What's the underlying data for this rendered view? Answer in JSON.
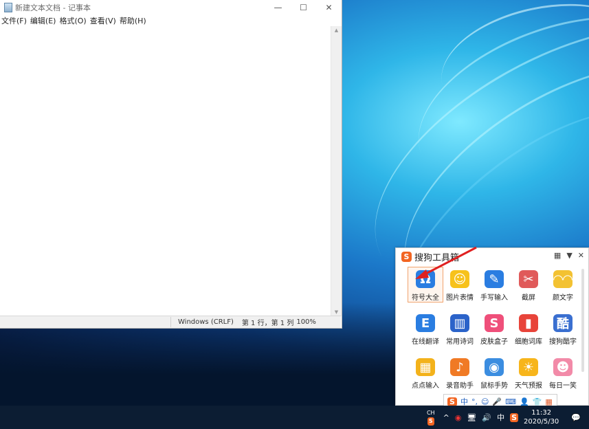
{
  "notepad": {
    "title": "新建文本文档 - 记事本",
    "controls": {
      "minimize": "—",
      "maximize": "☐",
      "close": "✕"
    },
    "menu": [
      "文件(F)",
      "编辑(E)",
      "格式(O)",
      "查看(V)",
      "帮助(H)"
    ],
    "status": {
      "line_ending": "Windows (CRLF)",
      "position": "第 1 行，第 1 列",
      "zoom": "100%"
    }
  },
  "toolbox": {
    "logo": "S",
    "title": "搜狗工具箱",
    "header_buttons": {
      "layout": "▦",
      "dropdown": "▼",
      "close": "✕"
    },
    "tools": [
      {
        "label": "符号大全",
        "glyph": "Ω",
        "color": "#2a7de1",
        "icon": "omega-icon",
        "selected": true
      },
      {
        "label": "图片表情",
        "glyph": "☺",
        "color": "#f7c21b",
        "icon": "smiley-icon",
        "selected": false
      },
      {
        "label": "手写输入",
        "glyph": "✎",
        "color": "#2a7de1",
        "icon": "pen-icon",
        "selected": false
      },
      {
        "label": "截屏",
        "glyph": "✂",
        "color": "#e05a5a",
        "icon": "scissors-icon",
        "selected": false
      },
      {
        "label": "颜文字",
        "glyph": "◠◠",
        "color": "#f3c232",
        "icon": "kaomoji-icon",
        "selected": false
      },
      {
        "label": "在线翻译",
        "glyph": "E",
        "color": "#2a7de1",
        "icon": "translate-icon",
        "selected": false
      },
      {
        "label": "常用诗词",
        "glyph": "▥",
        "color": "#2b63c9",
        "icon": "book-icon",
        "selected": false
      },
      {
        "label": "皮肤盒子",
        "glyph": "S",
        "color": "#ef4f7a",
        "icon": "shirt-icon",
        "selected": false
      },
      {
        "label": "细胞词库",
        "glyph": "▮",
        "color": "#e8443a",
        "icon": "dictionary-icon",
        "selected": false
      },
      {
        "label": "搜狗酷字",
        "glyph": "酷",
        "color": "#3a6fd0",
        "icon": "cool-font-icon",
        "selected": false
      },
      {
        "label": "点点输入",
        "glyph": "▦",
        "color": "#f3b21b",
        "icon": "dot-input-icon",
        "selected": false
      },
      {
        "label": "录音助手",
        "glyph": "♪",
        "color": "#f07a25",
        "icon": "recorder-icon",
        "selected": false
      },
      {
        "label": "鼠标手势",
        "glyph": "◉",
        "color": "#3b8de0",
        "icon": "mouse-icon",
        "selected": false
      },
      {
        "label": "天气预报",
        "glyph": "☀",
        "color": "#f7b51b",
        "icon": "sun-icon",
        "selected": false
      },
      {
        "label": "每日一笑",
        "glyph": "☻",
        "color": "#f28aa8",
        "icon": "laugh-icon",
        "selected": false
      }
    ]
  },
  "imebar": {
    "logo": "S",
    "mode": "中",
    "punct": "°,",
    "emoji": "☺",
    "mic": "🎤",
    "keyboard": "⌨",
    "user": "👤",
    "skin": "👕",
    "grid": "▦"
  },
  "taskbar": {
    "lang": "CH",
    "ime_logo": "S",
    "chevron": "^",
    "network": "🖥",
    "volume": "🔊",
    "ime_mode": "中",
    "time": "11:32",
    "date": "2020/5/30",
    "notification": "💬"
  },
  "colors": {
    "accent": "#f26522",
    "taskbar": "#0c1d33"
  }
}
